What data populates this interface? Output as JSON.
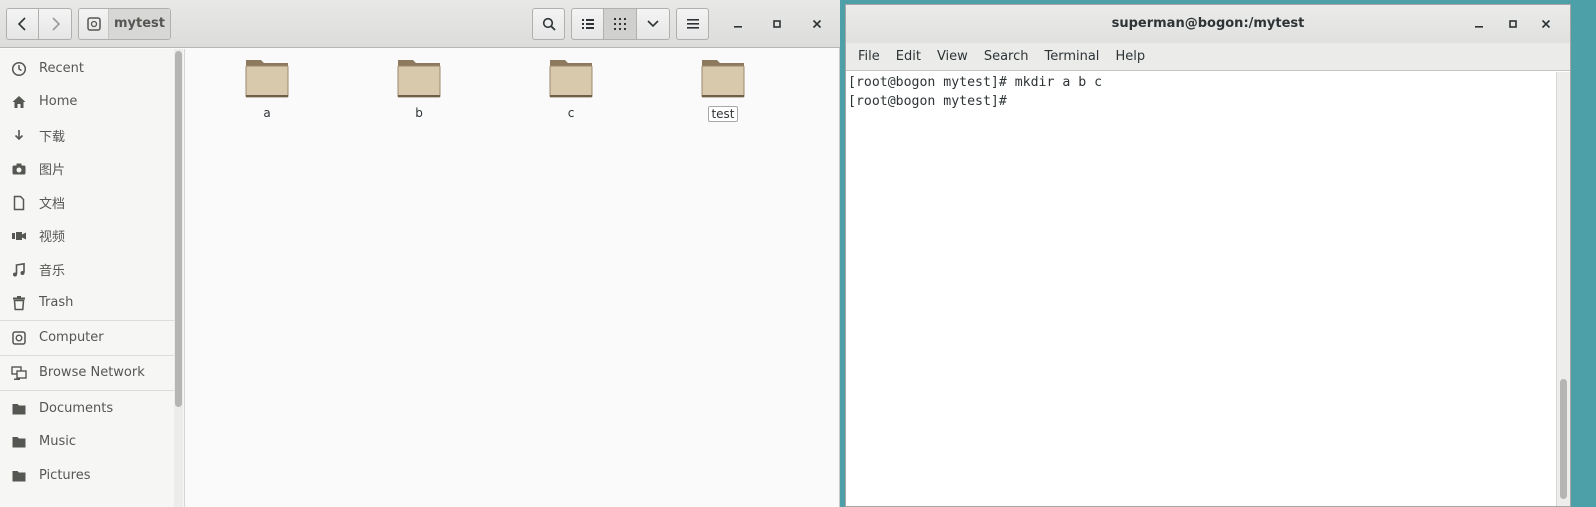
{
  "files": {
    "path_label": "mytest",
    "sidebar": {
      "items": [
        {
          "label": "Recent",
          "icon": "clock-icon"
        },
        {
          "label": "Home",
          "icon": "home-icon"
        },
        {
          "label": "下载",
          "icon": "download-icon"
        },
        {
          "label": "图片",
          "icon": "camera-icon"
        },
        {
          "label": "文档",
          "icon": "document-icon"
        },
        {
          "label": "视频",
          "icon": "video-icon"
        },
        {
          "label": "音乐",
          "icon": "music-icon"
        },
        {
          "label": "Trash",
          "icon": "trash-icon"
        },
        {
          "label": "Computer",
          "icon": "computer-icon"
        },
        {
          "label": "Browse Network",
          "icon": "network-icon"
        },
        {
          "label": "Documents",
          "icon": "folder-icon"
        },
        {
          "label": "Music",
          "icon": "folder-icon"
        },
        {
          "label": "Pictures",
          "icon": "folder-icon"
        }
      ]
    },
    "folders": [
      {
        "name": "a"
      },
      {
        "name": "b"
      },
      {
        "name": "c"
      },
      {
        "name": "test"
      }
    ]
  },
  "terminal": {
    "title": "superman@bogon:/mytest",
    "menu": [
      "File",
      "Edit",
      "View",
      "Search",
      "Terminal",
      "Help"
    ],
    "lines": [
      "[root@bogon mytest]# mkdir a b c",
      "[root@bogon mytest]# "
    ]
  },
  "colors": {
    "folder_body": "#d8c8ac",
    "folder_tab": "#8d7a5e",
    "desktop": "#4d9fa8"
  }
}
